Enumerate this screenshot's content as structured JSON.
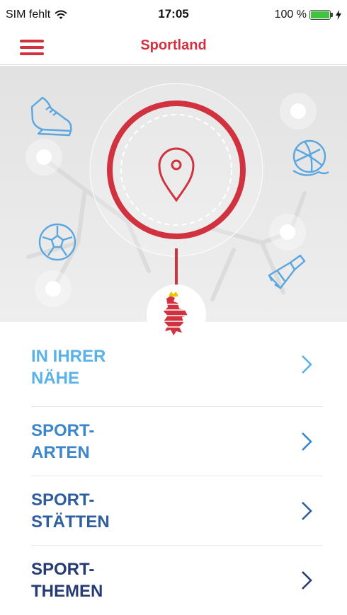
{
  "status_bar": {
    "carrier": "SIM fehlt",
    "time": "17:05",
    "battery": "100 %"
  },
  "navbar": {
    "title": "Sportland",
    "menu_icon": "hamburger-menu-icon"
  },
  "colors": {
    "brand_red": "#d0323f",
    "sport_icon_blue": "#5aa7e0",
    "item_1": "#5ab2e8",
    "item_2": "#3c87cc",
    "item_3": "#2e5e9e",
    "item_4": "#253b73"
  },
  "hero": {
    "center_icon": "location-pin-icon",
    "sport_icons": [
      "sneaker-icon",
      "volleyball-icon",
      "soccer-ball-icon",
      "shuttlecock-icon"
    ],
    "emblem": "hessen-lion-crest"
  },
  "menu": [
    {
      "line1": "IN IHRER",
      "line2": "NÄHE",
      "color": "#5ab2e8"
    },
    {
      "line1": "SPORT-",
      "line2": "ARTEN",
      "color": "#3c87cc"
    },
    {
      "line1": "SPORT-",
      "line2": "STÄTTEN",
      "color": "#2e5e9e"
    },
    {
      "line1": "SPORT-",
      "line2": "THEMEN",
      "color": "#253b73"
    }
  ]
}
